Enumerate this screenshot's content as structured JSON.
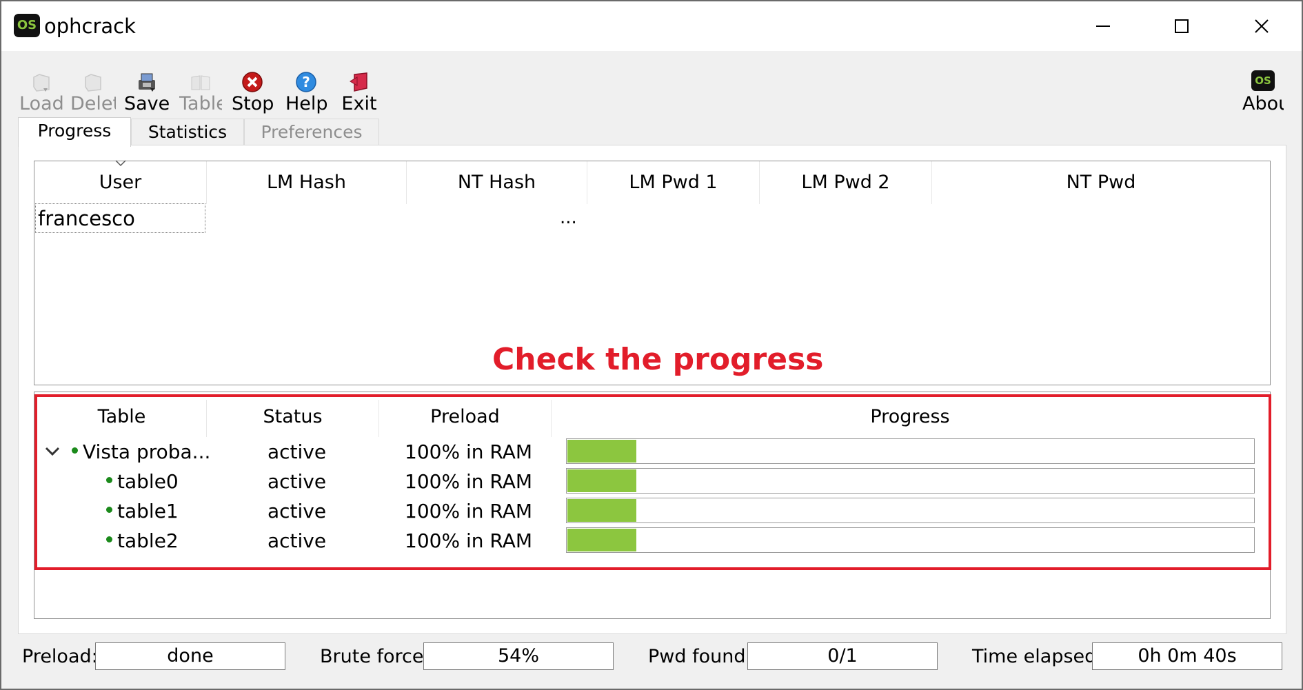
{
  "window": {
    "title": "ophcrack",
    "logo_text": "OS"
  },
  "toolbar": {
    "load_label": "Load",
    "delete_label": "Delete",
    "save_label": "Save",
    "tables_label": "Tables",
    "stop_label": "Stop",
    "help_label": "Help",
    "exit_label": "Exit",
    "about_label": "About",
    "about_logo_text": "OS"
  },
  "tabs": [
    {
      "label": "Progress",
      "state": "active"
    },
    {
      "label": "Statistics",
      "state": "normal"
    },
    {
      "label": "Preferences",
      "state": "disabled"
    }
  ],
  "users_table": {
    "columns": [
      "User",
      "LM Hash",
      "NT Hash",
      "LM Pwd 1",
      "LM Pwd 2",
      "NT Pwd"
    ],
    "rows": [
      {
        "user": "francesco",
        "lm_hash": "",
        "nt_hash": "...",
        "lm_pwd1": "",
        "lm_pwd2": "",
        "nt_pwd": ""
      }
    ]
  },
  "annotation": {
    "text": "Check the progress",
    "color": "#e21d2a"
  },
  "tables_table": {
    "columns": [
      "Table",
      "Status",
      "Preload",
      "Progress"
    ],
    "rows": [
      {
        "name": "Vista proba...",
        "status": "active",
        "preload": "100% in RAM",
        "progress": 0.1,
        "level": 0,
        "expanded": true
      },
      {
        "name": "table0",
        "status": "active",
        "preload": "100% in RAM",
        "progress": 0.1,
        "level": 1
      },
      {
        "name": "table1",
        "status": "active",
        "preload": "100% in RAM",
        "progress": 0.1,
        "level": 1
      },
      {
        "name": "table2",
        "status": "active",
        "preload": "100% in RAM",
        "progress": 0.1,
        "level": 1
      }
    ],
    "progress_color": "#8cc63f"
  },
  "status_bar": {
    "preload_label": "Preload:",
    "preload_value": "done",
    "brute_force_label": "Brute force:",
    "brute_force_value": "54%",
    "pwd_found_label": "Pwd found:",
    "pwd_found_value": "0/1",
    "time_elapsed_label": "Time elapsed:",
    "time_elapsed_value": "0h 0m 40s"
  }
}
